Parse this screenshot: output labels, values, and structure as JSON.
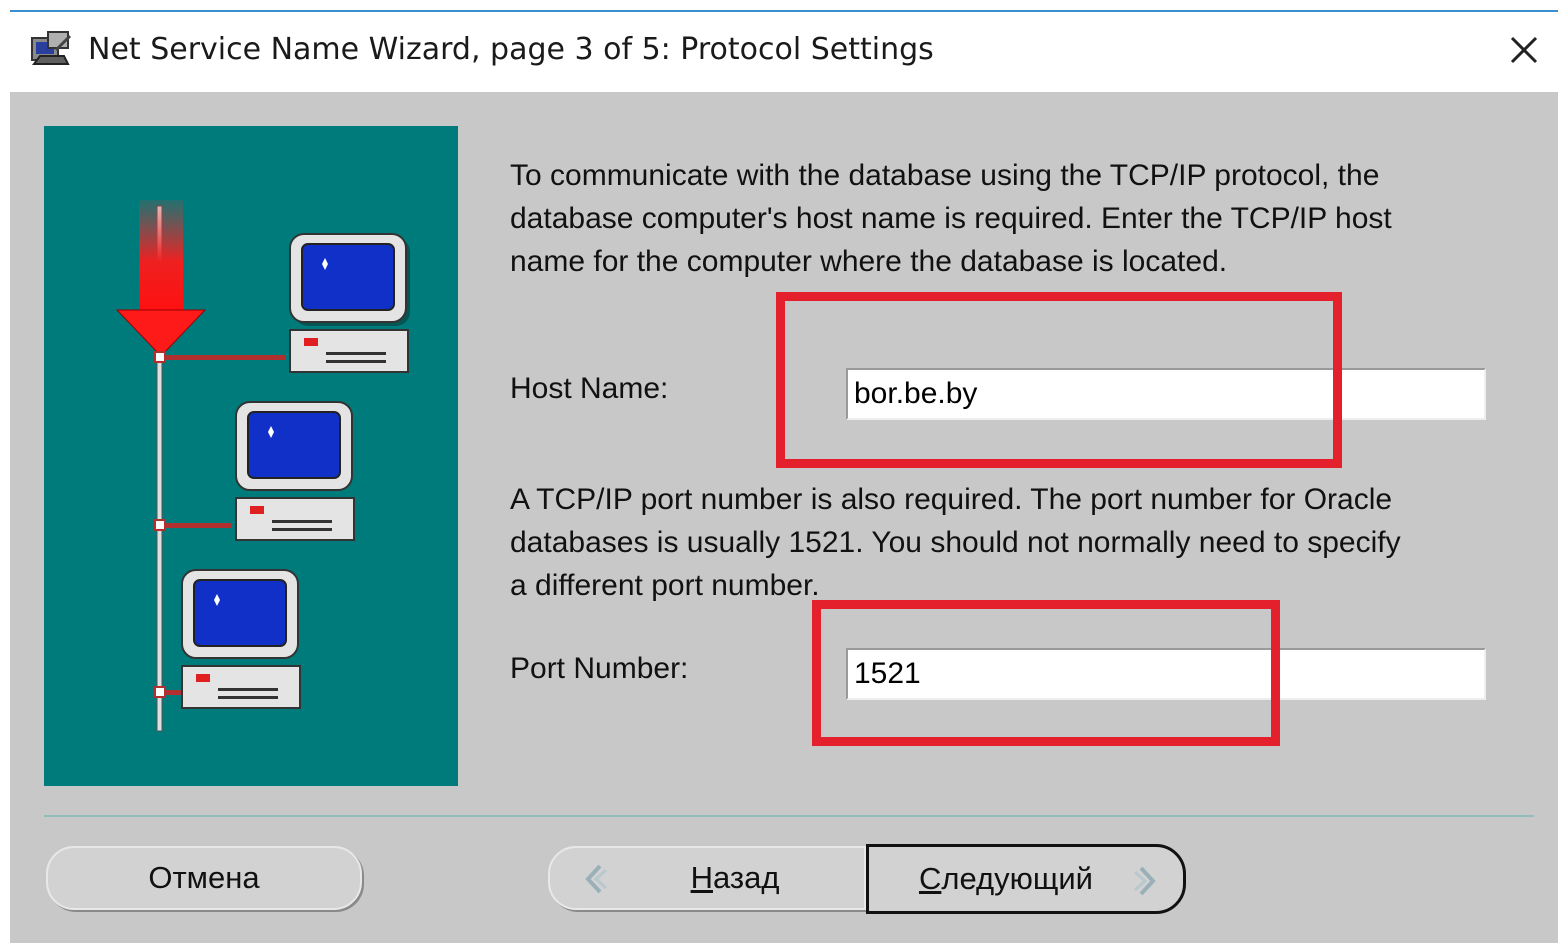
{
  "window": {
    "title": "Net Service Name Wizard, page 3 of 5: Protocol Settings",
    "icon": "wizard-icon"
  },
  "content": {
    "intro_lines": [
      "To communicate with the database using the TCP/IP protocol, the",
      "database computer's host name is required.  Enter the TCP/IP host",
      "name for the computer where the database is located."
    ],
    "host_label": "Host Name:",
    "host_value": "bor.be.by",
    "port_lines": [
      "A TCP/IP port number is also required.  The port number for Oracle",
      "databases is usually 1521.  You should not normally need to specify",
      "a different port number."
    ],
    "port_label": "Port Number:",
    "port_value": "1521"
  },
  "buttons": {
    "cancel": "Отмена",
    "back_first": "Н",
    "back_rest": "азад",
    "next_first": "С",
    "next_rest": "ледующий"
  },
  "colors": {
    "illustration_bg": "#007b7b",
    "highlight": "#e3202c",
    "screen": "#1030c8"
  }
}
